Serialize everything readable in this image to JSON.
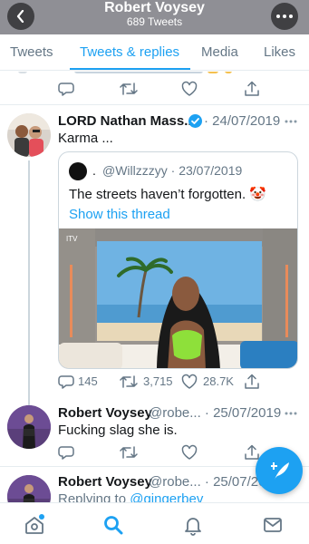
{
  "header": {
    "title": "Robert Voysey",
    "subtitle": "689 Tweets"
  },
  "tabs": [
    {
      "label": "Tweets",
      "active": false
    },
    {
      "label": "Tweets & replies",
      "active": true
    },
    {
      "label": "Media",
      "active": false
    },
    {
      "label": "Likes",
      "active": false
    }
  ],
  "tweets": [
    {
      "name": "LORD Nathan Mass...",
      "verified": true,
      "meta": "· 24/07/2019",
      "text": "Karma ...",
      "quote": {
        "name": ".",
        "handle": "@Willzzzyy · 23/07/2019",
        "text": "The streets haven’t forgotten. 🤡",
        "link": "Show this thread"
      },
      "counts": {
        "replies": "145",
        "retweets": "3,715",
        "likes": "28.7K"
      }
    },
    {
      "name": "Robert Voysey",
      "meta": "@robe... · 25/07/2019",
      "text": "Fucking slag she is."
    },
    {
      "name": "Robert Voysey",
      "meta": "@robe... · 25/07/20",
      "reply_prefix": "Replying to ",
      "reply_handle": "@gingerbev"
    }
  ],
  "colors": {
    "accent": "#1da1f2",
    "header_bg": "#8f8f95",
    "muted": "#657786"
  }
}
